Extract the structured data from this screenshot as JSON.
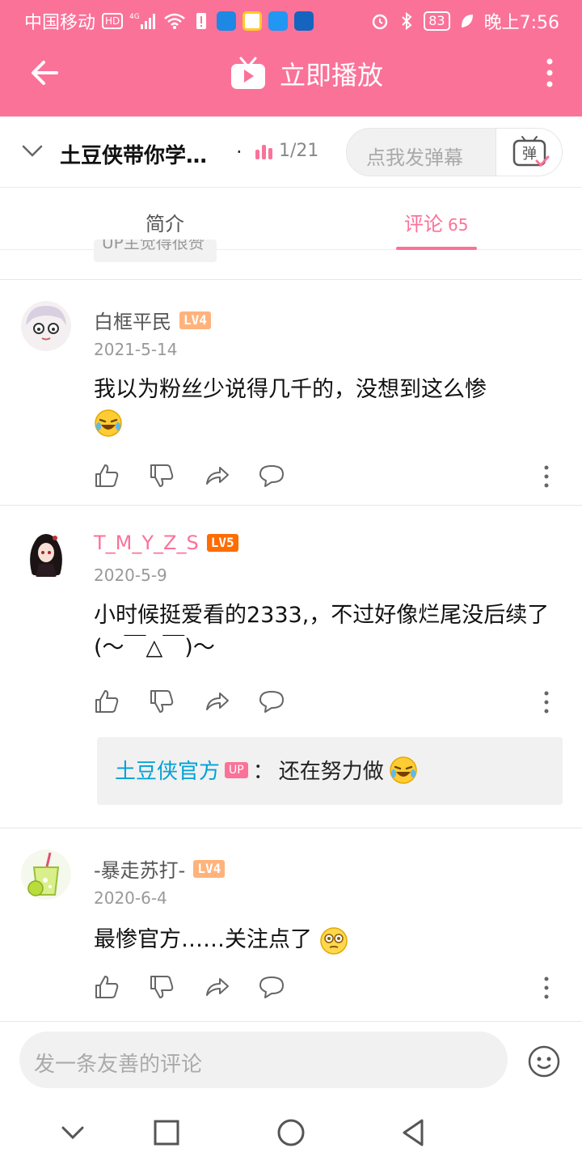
{
  "status_bar": {
    "carrier": "中国移动",
    "hd": "HD",
    "network": "4G",
    "battery": "83",
    "time": "晚上7:56"
  },
  "header": {
    "title": "立即播放"
  },
  "video": {
    "title": "土豆侠带你学…",
    "separator": "·",
    "episode": "1/21",
    "danmaku_placeholder": "点我发弹幕",
    "danmaku_icon_label": "弹"
  },
  "tabs": {
    "intro": "简介",
    "comments": "评论",
    "comments_count": "65"
  },
  "partial_tag": "UP主觉得很赞",
  "comments": [
    {
      "user": "白框平民",
      "level": "LV4",
      "date": "2021-5-14",
      "text": "我以为粉丝少说得几千的，没想到这么惨"
    },
    {
      "user": "T_M_Y_Z_S",
      "level": "LV5",
      "date": "2020-5-9",
      "text": "小时候挺爱看的2333,，不过好像烂尾没后续了(〜￣△￣)〜",
      "reply": {
        "user": "土豆侠官方",
        "badge": "UP",
        "sep": "：",
        "text": "还在努力做"
      }
    },
    {
      "user": "-暴走苏打-",
      "level": "LV4",
      "date": "2020-6-4",
      "text": "最惨官方……关注点了"
    }
  ],
  "bottom": {
    "placeholder": "发一条友善的评论"
  },
  "colors": {
    "brand_pink": "#fb7299",
    "reply_blue": "#00a1d6"
  }
}
